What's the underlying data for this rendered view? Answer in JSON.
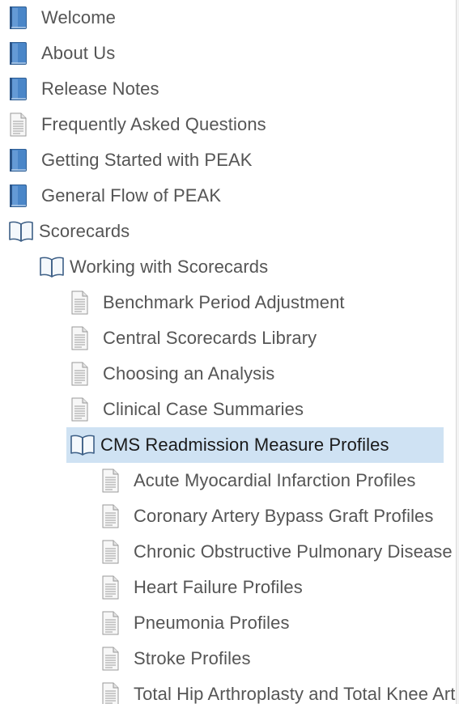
{
  "tree": {
    "items": [
      {
        "label": "Welcome",
        "icon": "closed-book-icon",
        "level": 0,
        "selected": false
      },
      {
        "label": "About Us",
        "icon": "closed-book-icon",
        "level": 0,
        "selected": false
      },
      {
        "label": "Release Notes",
        "icon": "closed-book-icon",
        "level": 0,
        "selected": false
      },
      {
        "label": "Frequently Asked Questions",
        "icon": "page-icon",
        "level": 0,
        "selected": false
      },
      {
        "label": "Getting Started with PEAK",
        "icon": "closed-book-icon",
        "level": 0,
        "selected": false
      },
      {
        "label": "General Flow of PEAK",
        "icon": "closed-book-icon",
        "level": 0,
        "selected": false
      },
      {
        "label": "Scorecards",
        "icon": "open-book-icon",
        "level": 0,
        "selected": false
      },
      {
        "label": "Working with Scorecards",
        "icon": "open-book-icon",
        "level": 1,
        "selected": false
      },
      {
        "label": "Benchmark Period Adjustment",
        "icon": "page-icon",
        "level": 2,
        "selected": false
      },
      {
        "label": "Central Scorecards Library",
        "icon": "page-icon",
        "level": 2,
        "selected": false
      },
      {
        "label": "Choosing an Analysis",
        "icon": "page-icon",
        "level": 2,
        "selected": false
      },
      {
        "label": "Clinical Case Summaries",
        "icon": "page-icon",
        "level": 2,
        "selected": false
      },
      {
        "label": "CMS Readmission Measure Profiles",
        "icon": "open-book-icon",
        "level": 2,
        "selected": true
      },
      {
        "label": "Acute Myocardial Infarction Profiles",
        "icon": "page-icon",
        "level": 3,
        "selected": false
      },
      {
        "label": "Coronary Artery Bypass Graft Profiles",
        "icon": "page-icon",
        "level": 3,
        "selected": false
      },
      {
        "label": "Chronic Obstructive Pulmonary Disease Profiles",
        "icon": "page-icon",
        "level": 3,
        "selected": false
      },
      {
        "label": "Heart Failure Profiles",
        "icon": "page-icon",
        "level": 3,
        "selected": false
      },
      {
        "label": "Pneumonia Profiles",
        "icon": "page-icon",
        "level": 3,
        "selected": false
      },
      {
        "label": "Stroke Profiles",
        "icon": "page-icon",
        "level": 3,
        "selected": false
      },
      {
        "label": "Total Hip Arthroplasty and Total Knee Arthroplasty Profiles",
        "icon": "page-icon",
        "level": 3,
        "selected": false
      }
    ]
  },
  "colors": {
    "selection_background": "#cfe2f3",
    "label_text": "#555555",
    "book_cover": "#3f77b5"
  }
}
